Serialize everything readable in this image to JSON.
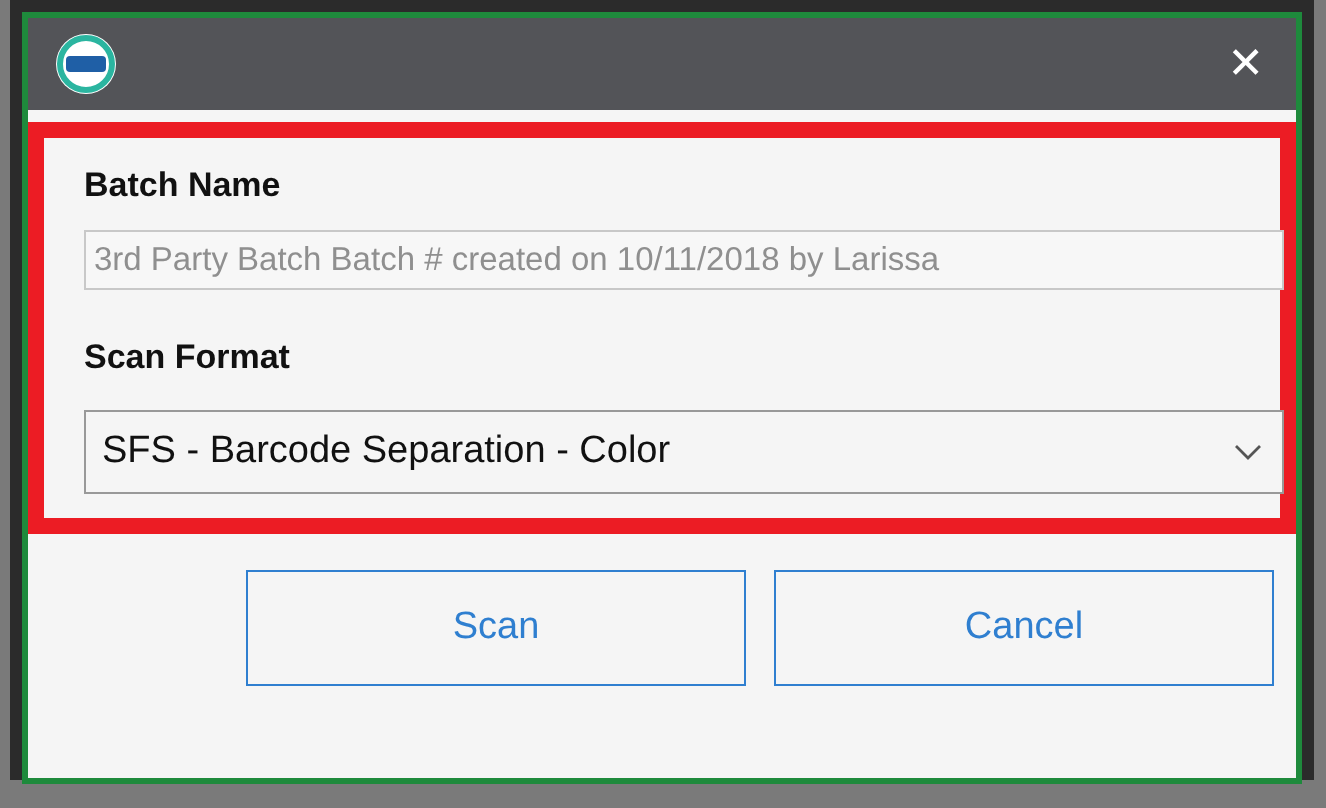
{
  "dialog": {
    "close_icon": "✕"
  },
  "batch_name": {
    "label": "Batch Name",
    "value": "3rd Party Batch Batch # created on 10/11/2018 by Larissa",
    "disabled": true
  },
  "scan_format": {
    "label": "Scan Format",
    "value": "SFS - Barcode Separation - Color"
  },
  "buttons": [
    {
      "label": "Scan"
    },
    {
      "label": "Cancel"
    }
  ]
}
